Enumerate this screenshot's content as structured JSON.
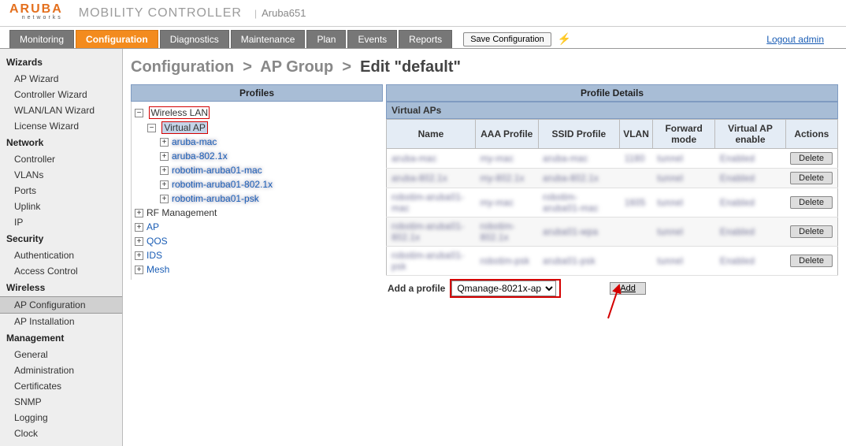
{
  "header": {
    "brand_top": "ARUBA",
    "brand_sub": "networks",
    "product": "MOBILITY CONTROLLER",
    "hostname": "Aruba651"
  },
  "tabs": {
    "monitoring": "Monitoring",
    "configuration": "Configuration",
    "diagnostics": "Diagnostics",
    "maintenance": "Maintenance",
    "plan": "Plan",
    "events": "Events",
    "reports": "Reports",
    "save": "Save Configuration",
    "logout": "Logout admin"
  },
  "sidebar": {
    "wizards_h": "Wizards",
    "wizards": [
      "AP Wizard",
      "Controller Wizard",
      "WLAN/LAN Wizard",
      "License Wizard"
    ],
    "network_h": "Network",
    "network": [
      "Controller",
      "VLANs",
      "Ports",
      "Uplink",
      "IP"
    ],
    "security_h": "Security",
    "security": [
      "Authentication",
      "Access Control"
    ],
    "wireless_h": "Wireless",
    "wireless": [
      "AP Configuration",
      "AP Installation"
    ],
    "management_h": "Management",
    "management": [
      "General",
      "Administration",
      "Certificates",
      "SNMP",
      "Logging",
      "Clock"
    ]
  },
  "breadcrumb": {
    "a": "Configuration",
    "b": "AP Group",
    "c": "Edit \"default\""
  },
  "panels": {
    "profiles_title": "Profiles",
    "details_title": "Profile Details"
  },
  "tree": {
    "wlan": "Wireless LAN",
    "vap": "Virtual AP",
    "children_blur": [
      "aruba-mac",
      "aruba-802.1x",
      "robotim-aruba01-mac",
      "robotim-aruba01-802.1x",
      "robotim-aruba01-psk"
    ],
    "rf": "RF Management",
    "ap": "AP",
    "qos": "QOS",
    "ids": "IDS",
    "mesh": "Mesh"
  },
  "vap_table": {
    "header": "Virtual APs",
    "cols": [
      "Name",
      "AAA Profile",
      "SSID Profile",
      "VLAN",
      "Forward mode",
      "Virtual AP enable",
      "Actions"
    ],
    "rows": [
      {
        "name": "aruba-mac",
        "aaa": "my-mac",
        "ssid": "aruba-mac",
        "vlan": "1180",
        "fwd": "tunnel",
        "en": "Enabled"
      },
      {
        "name": "aruba-802.1x",
        "aaa": "my-802.1x",
        "ssid": "aruba-802.1x",
        "vlan": "",
        "fwd": "tunnel",
        "en": "Enabled"
      },
      {
        "name": "robotim-aruba01-mac",
        "aaa": "my-mac",
        "ssid": "robotim-aruba01-mac",
        "vlan": "1605",
        "fwd": "tunnel",
        "en": "Enabled"
      },
      {
        "name": "robotim-aruba01-802.1x",
        "aaa": "robotim-802.1x",
        "ssid": "aruba01-wpa",
        "vlan": "",
        "fwd": "tunnel",
        "en": "Enabled"
      },
      {
        "name": "robotim-aruba01-psk",
        "aaa": "robotim-psk",
        "ssid": "aruba01-psk",
        "vlan": "",
        "fwd": "tunnel",
        "en": "Enabled"
      }
    ],
    "delete": "Delete"
  },
  "addrow": {
    "label": "Add a profile",
    "selected": "Qmanage-8021x-ap",
    "add": "Add"
  }
}
